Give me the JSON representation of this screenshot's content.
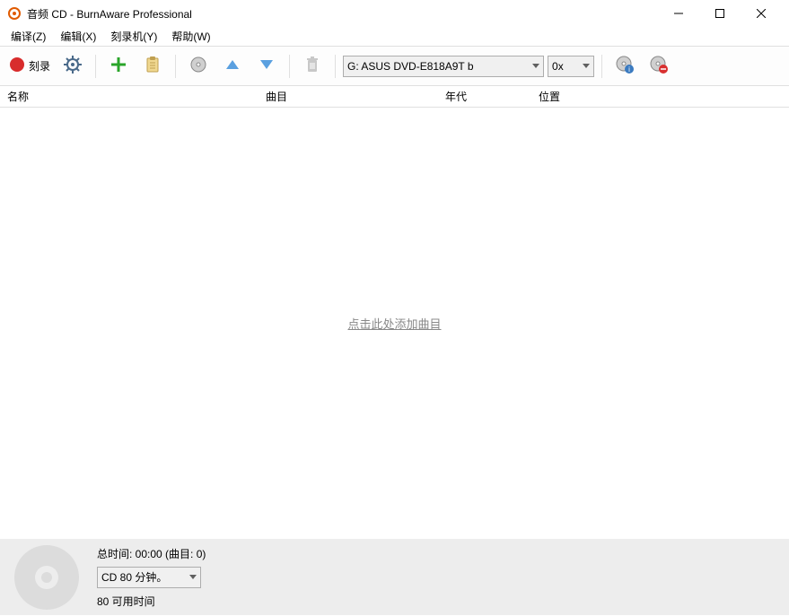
{
  "window": {
    "title": "音频 CD - BurnAware Professional"
  },
  "menu": {
    "translate": "编译(Z)",
    "edit": "编辑(X)",
    "burner": "刻录机(Y)",
    "help": "帮助(W)"
  },
  "toolbar": {
    "burn_label": "刻录",
    "drive": "G: ASUS DVD-E818A9T   b",
    "speed": "0x"
  },
  "columns": {
    "name": "名称",
    "track": "曲目",
    "year": "年代",
    "position": "位置"
  },
  "main": {
    "add_link": "点击此处添加曲目"
  },
  "status": {
    "total_time": "总时间: 00:00 (曲目: 0)",
    "disc_type": "CD 80 分钟。",
    "avail": "80 可用时间"
  }
}
